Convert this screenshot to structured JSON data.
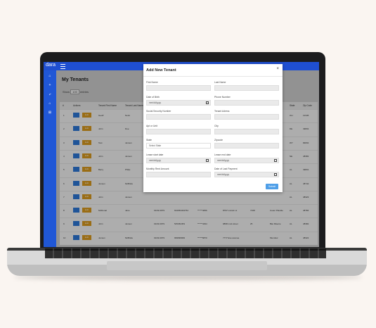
{
  "app": {
    "brand": "dara"
  },
  "page": {
    "title": "My Tenants",
    "show": {
      "prefix": "Show",
      "count": "100",
      "suffix": "entries"
    }
  },
  "sidebar": {
    "items": [
      "⌂",
      "+",
      "⤶",
      "⌂",
      "⊞"
    ]
  },
  "table": {
    "headers": [
      "#",
      "Actions",
      "Tenant First Name",
      "Tenant Last Name",
      "State",
      "Zip Code"
    ],
    "edit_label": "Edit",
    "rows": [
      {
        "n": "1",
        "first": "Geoff",
        "last": "Nock",
        "state": "OH",
        "zip": "12345"
      },
      {
        "n": "2",
        "first": "John",
        "last": "Doe",
        "state": "DE",
        "zip": "49832"
      },
      {
        "n": "3",
        "first": "Test",
        "last": "Jensen",
        "state": "WY",
        "zip": "84832"
      },
      {
        "n": "4",
        "first": "John",
        "last": "Jensen",
        "state": "NE",
        "zip": "48382"
      },
      {
        "n": "5",
        "first": "Barry",
        "last": "Philip",
        "state": "AL",
        "zip": "49831"
      },
      {
        "n": "6",
        "first": "Jensen",
        "last": "McBride",
        "state": "AL",
        "zip": "48742"
      },
      {
        "n": "7",
        "first": "John",
        "last": "Jensen",
        "state": "AL",
        "zip": "48323"
      },
      {
        "n": "8",
        "first": "McDonal",
        "last": "Jane",
        "dob": "01/01/1979",
        "ssn": "634353434754",
        "phone": "******4656",
        "addr": "8797 Lincoln st",
        "apt": "7108",
        "city": "Coeur Placide",
        "state": "AL",
        "zip": "48784"
      },
      {
        "n": "9",
        "first": "John",
        "last": "Jensen",
        "dob": "01/01/1979",
        "ssn": "545452453",
        "phone": "******4394",
        "addr": "9898 mott street",
        "apt": "25",
        "city": "Blei Miserie",
        "state": "AL",
        "zip": "48382"
      },
      {
        "n": "10",
        "first": "Jensen",
        "last": "McBride",
        "dob": "01/01/1979",
        "ssn": "999999999",
        "phone": "******9870",
        "addr": "7777 Eve avenue",
        "apt": "",
        "city": "Mundsor",
        "state": "AL",
        "zip": "48322"
      }
    ]
  },
  "modal": {
    "title": "Add New Tenant",
    "close": "×",
    "fields": [
      {
        "label": "First Name",
        "value": ""
      },
      {
        "label": "Last Name",
        "value": ""
      },
      {
        "label": "Date of Birth",
        "value": "mm/dd/yyyy"
      },
      {
        "label": "Phone Number",
        "value": ""
      },
      {
        "label": "Social Security Number",
        "value": ""
      },
      {
        "label": "Tenant Adress",
        "value": ""
      },
      {
        "label": "Apt or Unit",
        "value": ""
      },
      {
        "label": "City",
        "value": ""
      },
      {
        "label": "State",
        "value": "Select State"
      },
      {
        "label": "Zipcode",
        "value": ""
      },
      {
        "label": "Lease start date",
        "value": "mm/dd/yyyy"
      },
      {
        "label": "Lease end date",
        "value": "mm/dd/yyyy"
      },
      {
        "label": "Monthly Rent Amount",
        "value": ""
      },
      {
        "label": "Date of Last Payment",
        "value": "mm/dd/yyyy"
      }
    ],
    "submit": "Submit"
  }
}
